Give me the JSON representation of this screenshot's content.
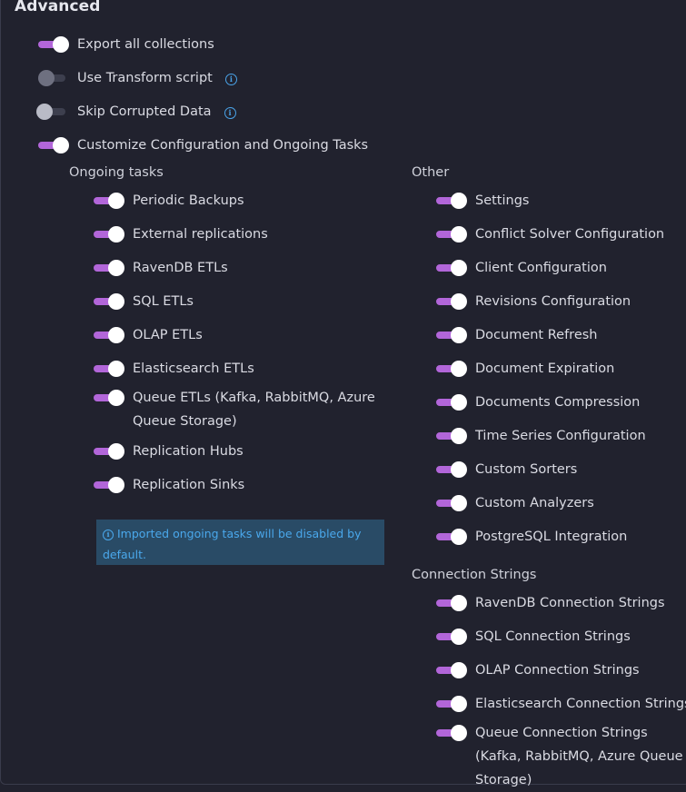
{
  "title": "Advanced",
  "main_options": [
    {
      "label": "Export all collections",
      "on": true,
      "info": false
    },
    {
      "label": "Use Transform script",
      "on": false,
      "info": true
    },
    {
      "label": "Skip Corrupted Data",
      "on": false,
      "info": true
    },
    {
      "label": "Customize Configuration and Ongoing Tasks",
      "on": true,
      "info": false
    }
  ],
  "ongoing_tasks": {
    "heading": "Ongoing tasks",
    "items": [
      {
        "label": "Periodic Backups"
      },
      {
        "label": "External replications"
      },
      {
        "label": "RavenDB ETLs"
      },
      {
        "label": "SQL ETLs"
      },
      {
        "label": "OLAP ETLs"
      },
      {
        "label": "Elasticsearch ETLs"
      },
      {
        "label": "Queue ETLs (Kafka, RabbitMQ, Azure Queue Storage)"
      },
      {
        "label": "Replication Hubs"
      },
      {
        "label": "Replication Sinks"
      }
    ]
  },
  "notice": {
    "icon": "info-icon",
    "text": "Imported ongoing tasks will be disabled by default."
  },
  "other": {
    "heading": "Other",
    "items": [
      {
        "label": "Settings"
      },
      {
        "label": "Conflict Solver Configuration"
      },
      {
        "label": "Client Configuration"
      },
      {
        "label": "Revisions Configuration"
      },
      {
        "label": "Document Refresh"
      },
      {
        "label": "Document Expiration"
      },
      {
        "label": "Documents Compression"
      },
      {
        "label": "Time Series Configuration"
      },
      {
        "label": "Custom Sorters"
      },
      {
        "label": "Custom Analyzers"
      },
      {
        "label": "PostgreSQL Integration"
      }
    ]
  },
  "connection_strings": {
    "heading": "Connection Strings",
    "items": [
      {
        "label": "RavenDB Connection Strings"
      },
      {
        "label": "SQL Connection Strings"
      },
      {
        "label": "OLAP Connection Strings"
      },
      {
        "label": "Elasticsearch Connection Strings"
      },
      {
        "label": "Queue Connection Strings (Kafka, RabbitMQ, Azure Queue Storage)"
      }
    ]
  },
  "colors": {
    "accent": "#b266d9",
    "info": "#4aa8ec",
    "background": "#21222e",
    "notice_bg": "#294b66"
  }
}
